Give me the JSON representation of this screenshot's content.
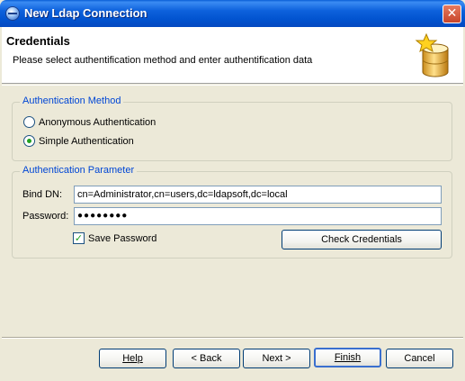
{
  "window": {
    "title": "New Ldap Connection",
    "close_glyph": "✕"
  },
  "banner": {
    "title": "Credentials",
    "description": "Please select authentification method and enter authentification data",
    "icon": "database-star-icon"
  },
  "auth_method": {
    "legend": "Authentication Method",
    "options": [
      {
        "label": "Anonymous Authentication",
        "selected": false
      },
      {
        "label": "Simple Authentication",
        "selected": true
      }
    ]
  },
  "auth_params": {
    "legend": "Authentication Parameter",
    "bind_dn_label": "Bind DN:",
    "bind_dn_value": "cn=Administrator,cn=users,dc=ldapsoft,dc=local",
    "password_label": "Password:",
    "password_value": "●●●●●●●●",
    "save_password_label": "Save Password",
    "save_password_checked": true,
    "check_credentials_label": "Check Credentials"
  },
  "footer": {
    "help_label": "Help",
    "back_label": "< Back",
    "next_label": "Next >",
    "finish_label": "Finish",
    "cancel_label": "Cancel"
  },
  "colors": {
    "titlebar": "#0254d0",
    "group_legend": "#0046d5",
    "dialog_bg": "#ece9d8"
  }
}
